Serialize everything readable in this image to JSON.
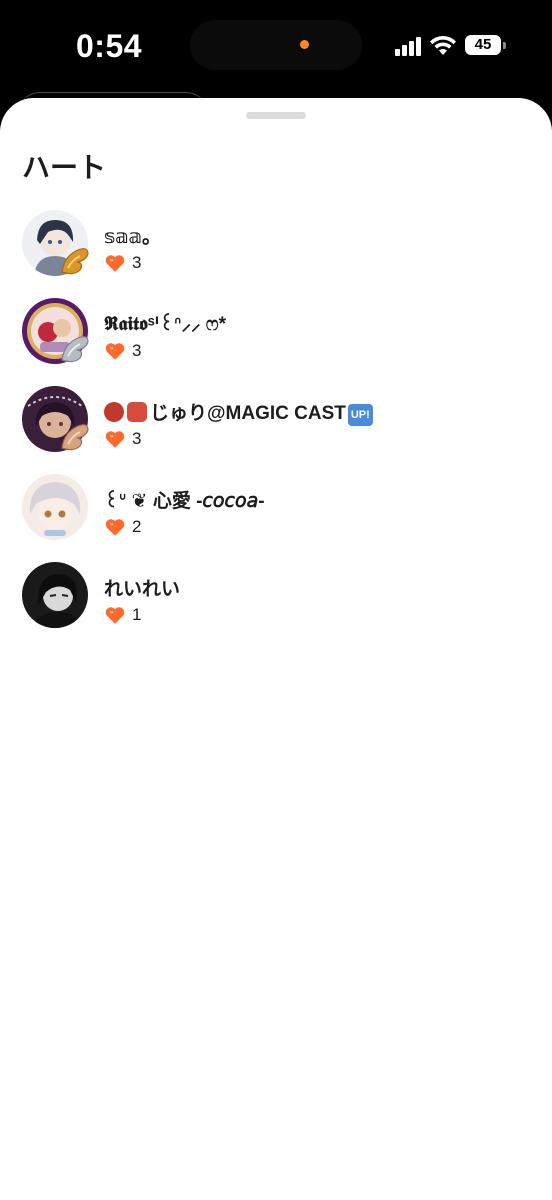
{
  "status_bar": {
    "time": "0:54",
    "battery": "45",
    "recording_indicator_color": "#ff8a1f"
  },
  "sheet": {
    "title": "ハート"
  },
  "likers": [
    {
      "name": "𝕤𝕒𝕒｡",
      "hearts": "3",
      "avatar_colors": [
        "#6d7f9e",
        "#e9ecf2"
      ],
      "badge_color": "#d9962a",
      "prefix_emojis": [],
      "suffix_badge": ""
    },
    {
      "name": "𝕽𝖆𝖎𝖙𝖔ˢᑊ꒰ᐢ⸝⸝ ෆ*",
      "hearts": "3",
      "avatar_colors": [
        "#8e2a44",
        "#f0c9c9"
      ],
      "badge_color": "#b8bcc4",
      "prefix_emojis": [],
      "suffix_badge": ""
    },
    {
      "name": "じゅり@MAGIC CAST",
      "hearts": "3",
      "avatar_colors": [
        "#3a1f3a",
        "#c79a7a"
      ],
      "badge_color": "#d6a37f",
      "prefix_emojis": [
        "ogre-emoji",
        "tengu-emoji"
      ],
      "suffix_badge": "UP!"
    },
    {
      "name": "꒰ᐡ ❦ 心愛 -𝘤𝘰𝘤𝘰𝘢-",
      "hearts": "2",
      "avatar_colors": [
        "#d8d2da",
        "#f5ece8"
      ],
      "badge_color": "",
      "prefix_emojis": [],
      "suffix_badge": ""
    },
    {
      "name": "れいれい",
      "hearts": "1",
      "avatar_colors": [
        "#1a1a1a",
        "#d9d9d9"
      ],
      "badge_color": "",
      "prefix_emojis": [],
      "suffix_badge": ""
    }
  ],
  "icons": {
    "heart": "heart-icon",
    "signal": "cellular-signal-icon",
    "wifi": "wifi-icon",
    "battery": "battery-icon"
  },
  "colors": {
    "heart": "#ff6a2a",
    "up_badge": "#4a8ad9",
    "ogre_emoji": "#c0392b",
    "tengu_emoji": "#d84a3c"
  }
}
